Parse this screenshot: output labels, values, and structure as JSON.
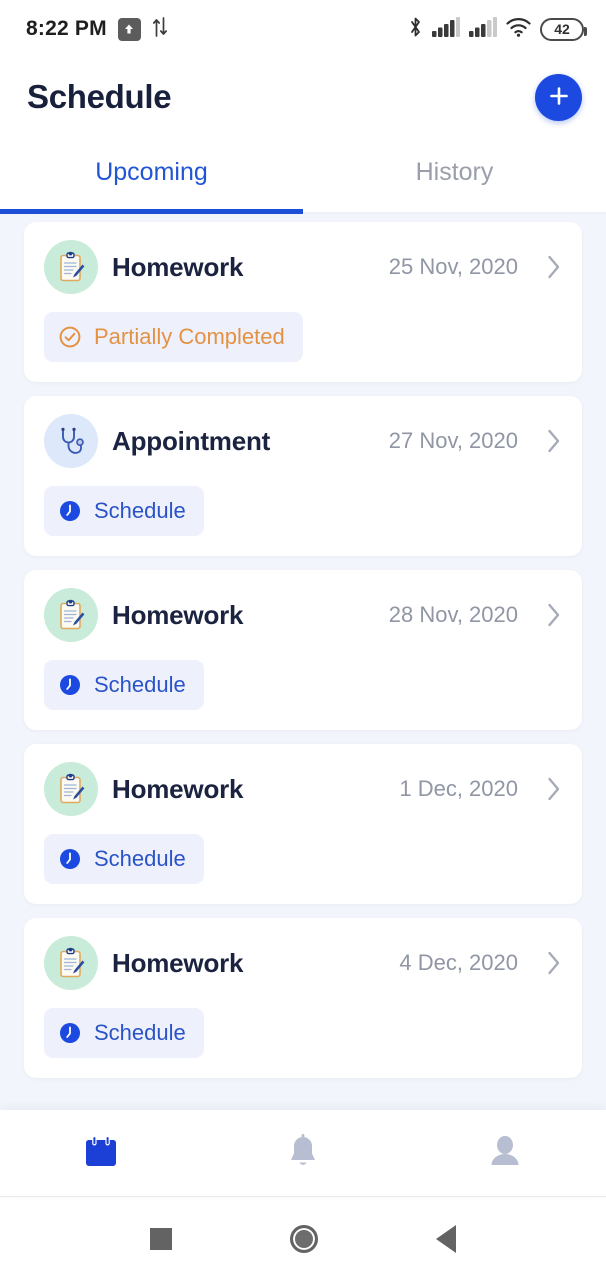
{
  "status_bar": {
    "time": "8:22 PM",
    "upload_icon": "upload-arrow-icon",
    "data_transfer_icon": "data-transfer-icon",
    "bluetooth_icon": "bluetooth-icon",
    "signal_icon_1": "cellular-signal-icon",
    "signal_icon_2": "cellular-signal-icon",
    "wifi_icon": "wifi-icon",
    "battery_level": "42"
  },
  "header": {
    "title": "Schedule",
    "add_button_label": "+",
    "add_button_icon": "plus-icon",
    "accent_color": "#1c4ae0"
  },
  "tabs": {
    "items": [
      {
        "label": "Upcoming",
        "active": true
      },
      {
        "label": "History",
        "active": false
      }
    ],
    "active_color": "#2255d6",
    "inactive_color": "#9a9eaa"
  },
  "list": {
    "cards": [
      {
        "icon": "clipboard-pen-icon",
        "icon_type": "homework",
        "title": "Homework",
        "date": "25 Nov, 2020",
        "chevron_icon": "chevron-right-icon",
        "badge": {
          "label": "Partially Completed",
          "icon": "check-circle-icon",
          "style": "partial",
          "color": "#e39244"
        }
      },
      {
        "icon": "stethoscope-icon",
        "icon_type": "appointment",
        "title": "Appointment",
        "date": "27 Nov, 2020",
        "chevron_icon": "chevron-right-icon",
        "badge": {
          "label": "Schedule",
          "icon": "clock-icon",
          "style": "schedule",
          "color": "#2a53c8"
        }
      },
      {
        "icon": "clipboard-pen-icon",
        "icon_type": "homework",
        "title": "Homework",
        "date": "28 Nov, 2020",
        "chevron_icon": "chevron-right-icon",
        "badge": {
          "label": "Schedule",
          "icon": "clock-icon",
          "style": "schedule",
          "color": "#2a53c8"
        }
      },
      {
        "icon": "clipboard-pen-icon",
        "icon_type": "homework",
        "title": "Homework",
        "date": "1 Dec, 2020",
        "chevron_icon": "chevron-right-icon",
        "badge": {
          "label": "Schedule",
          "icon": "clock-icon",
          "style": "schedule",
          "color": "#2a53c8"
        }
      },
      {
        "icon": "clipboard-pen-icon",
        "icon_type": "homework",
        "title": "Homework",
        "date": "4 Dec, 2020",
        "chevron_icon": "chevron-right-icon",
        "badge": {
          "label": "Schedule",
          "icon": "clock-icon",
          "style": "schedule",
          "color": "#2a53c8"
        }
      }
    ]
  },
  "bottom_nav": {
    "items": [
      {
        "icon": "calendar-icon",
        "active": true
      },
      {
        "icon": "bell-icon",
        "active": false
      },
      {
        "icon": "person-icon",
        "active": false
      }
    ],
    "active_color": "#1c3fd6",
    "inactive_color": "#b8bed1"
  },
  "android_nav": {
    "recents_icon": "square-recents-icon",
    "home_icon": "circle-home-icon",
    "back_icon": "triangle-back-icon"
  }
}
